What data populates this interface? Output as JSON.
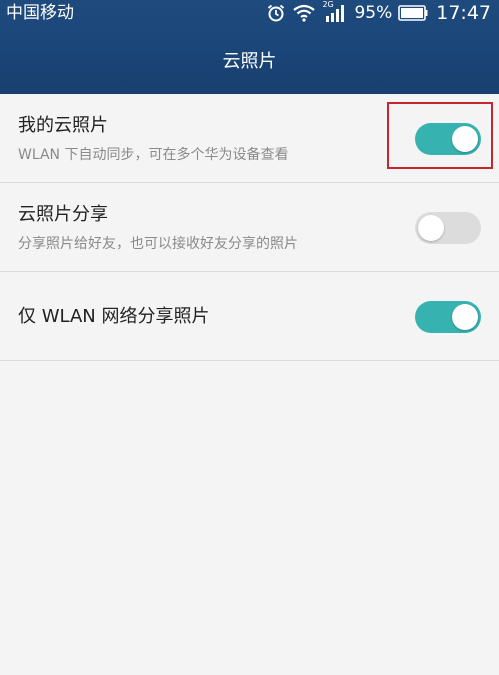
{
  "status_bar": {
    "carrier": "中国移动",
    "network_type": "2G",
    "battery_percent": "95%",
    "time": "17:47",
    "icons": [
      "alarm-icon",
      "wifi-icon",
      "signal-icon",
      "battery-icon"
    ]
  },
  "header": {
    "title": "云照片"
  },
  "settings": [
    {
      "title": "我的云照片",
      "subtitle": "WLAN 下自动同步，可在多个华为设备查看",
      "enabled": true
    },
    {
      "title": "云照片分享",
      "subtitle": "分享照片给好友，也可以接收好友分享的照片",
      "enabled": false
    },
    {
      "title": "仅 WLAN 网络分享照片",
      "enabled": true
    }
  ],
  "colors": {
    "header_bg": "#1b4679",
    "toggle_on": "#36b3b1",
    "toggle_off": "#dcdcdc",
    "highlight": "#c4262e",
    "background": "#f4f4f4"
  }
}
